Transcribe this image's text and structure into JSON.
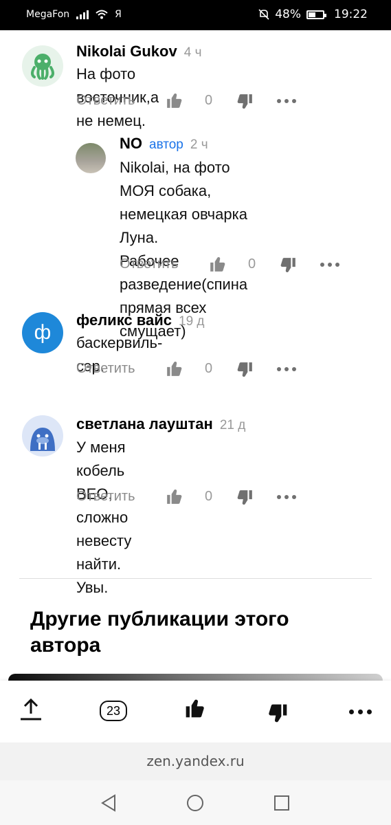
{
  "status_bar": {
    "carrier": "MegaFon",
    "browser_mark": "Я",
    "battery": "48%",
    "time": "19:22"
  },
  "comments": [
    {
      "author": "Nikolai Gukov",
      "time": "4 ч",
      "text": "На фото восточник,а не немец.",
      "reply": "Ответить",
      "likes": "0",
      "avatar_color": "#4caf6a"
    },
    {
      "author": "NO",
      "badge": "автор",
      "time": "2 ч",
      "text_lines": [
        "Nikolai, на фото МОЯ собака,",
        "немецкая овчарка Луна.",
        "Рабочее разведение(спина",
        "прямая всех смущает)"
      ],
      "reply": "Ответить",
      "likes": "0"
    },
    {
      "author": "феликс вайс",
      "time": "19 д",
      "text": "баскервиль-сэр.",
      "reply": "Ответить",
      "likes": "0",
      "avatar_letter": "ф",
      "avatar_color": "#1e88d9"
    },
    {
      "author": "светлана лауштан",
      "time": "21 д",
      "text_lines": [
        "У меня кобель ВЕО, сложно невесту",
        "найти. Увы."
      ],
      "reply": "Ответить",
      "likes": "0",
      "avatar_color": "#dde6f7"
    }
  ],
  "section": {
    "title": "Другие публикации этого автора"
  },
  "bottom_bar": {
    "comments_count": "23"
  },
  "url": "zen.yandex.ru"
}
